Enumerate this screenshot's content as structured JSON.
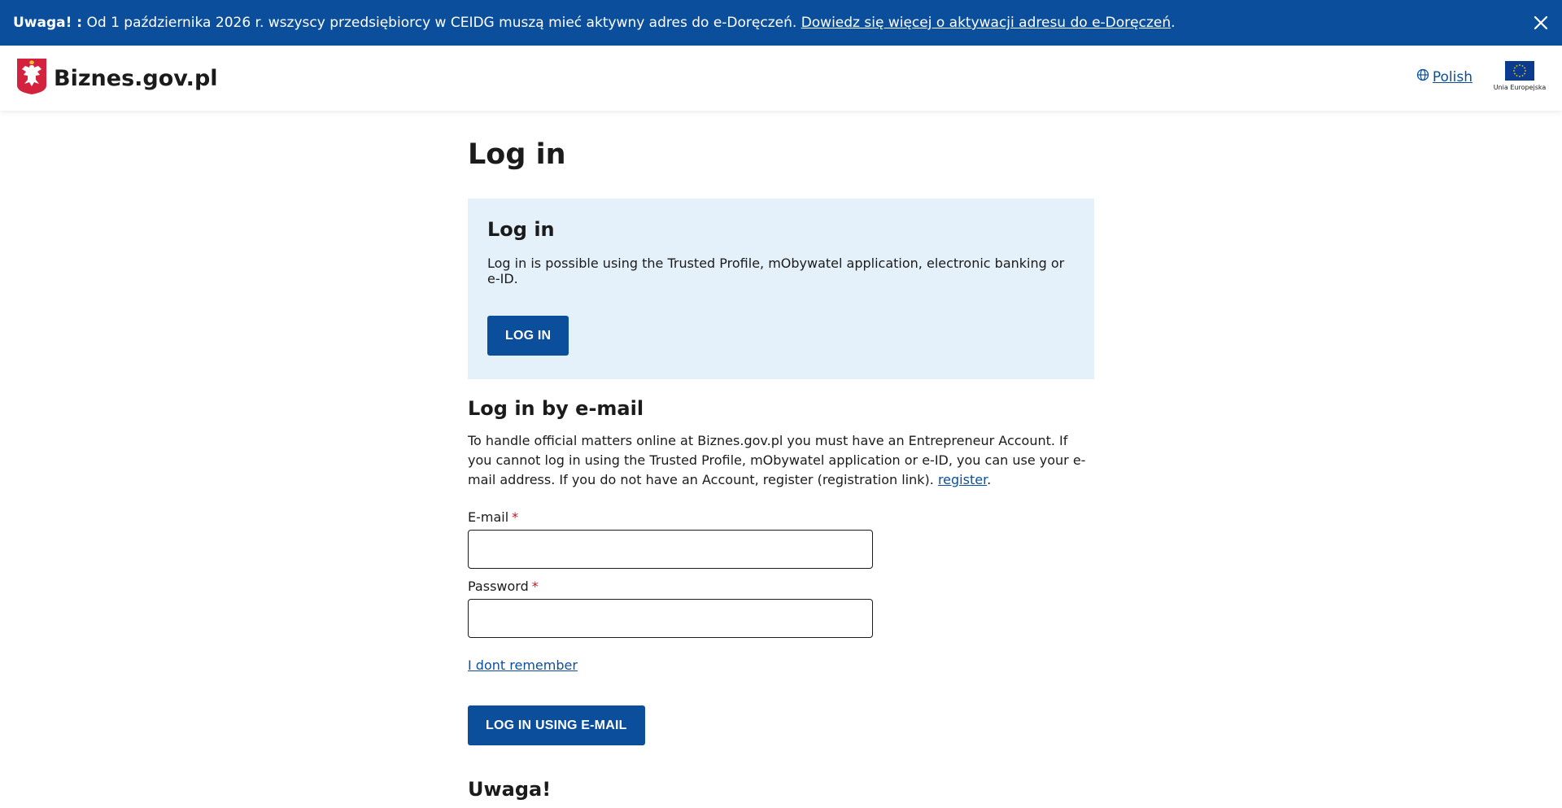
{
  "banner": {
    "bold": "Uwaga! :",
    "text": " Od 1 października 2026 r. wszyscy przedsiębiorcy w CEIDG muszą mieć aktywny adres do e-Doręczeń.",
    "link": "Dowiedz się więcej o aktywacji adresu do e-Doręczeń",
    "suffix": ".",
    "close_icon": "close-icon"
  },
  "header": {
    "logo_text": "Biznes.gov.pl",
    "logo_icon": "polish-eagle-emblem",
    "language": "Polish",
    "eu_label": "Unia Europejska"
  },
  "main": {
    "title": "Log in",
    "login_box": {
      "heading": "Log in",
      "text": "Log in is possible using the Trusted Profile, mObywatel application, electronic banking or e-ID.",
      "button": "LOG IN"
    },
    "email_section": {
      "heading": "Log in by e-mail",
      "description": "To handle official matters online at Biznes.gov.pl you must have an Entrepreneur Account. If you cannot log in using the Trusted Profile, mObywatel application or e-ID, you can use your e-mail address. If you do not have an Account, register (registration link). ",
      "register_link": "register",
      "description_end": ".",
      "email_label": "E-mail",
      "password_label": "Password",
      "required_mark": "*",
      "email_value": "",
      "password_value": "",
      "forgot_link": "I dont remember",
      "submit_button": "LOG IN USING E-MAIL"
    },
    "warning_heading": "Uwaga!"
  },
  "colors": {
    "primary": "#0b4f9c",
    "info_box": "#e5f1fa",
    "required": "#c4161c"
  }
}
